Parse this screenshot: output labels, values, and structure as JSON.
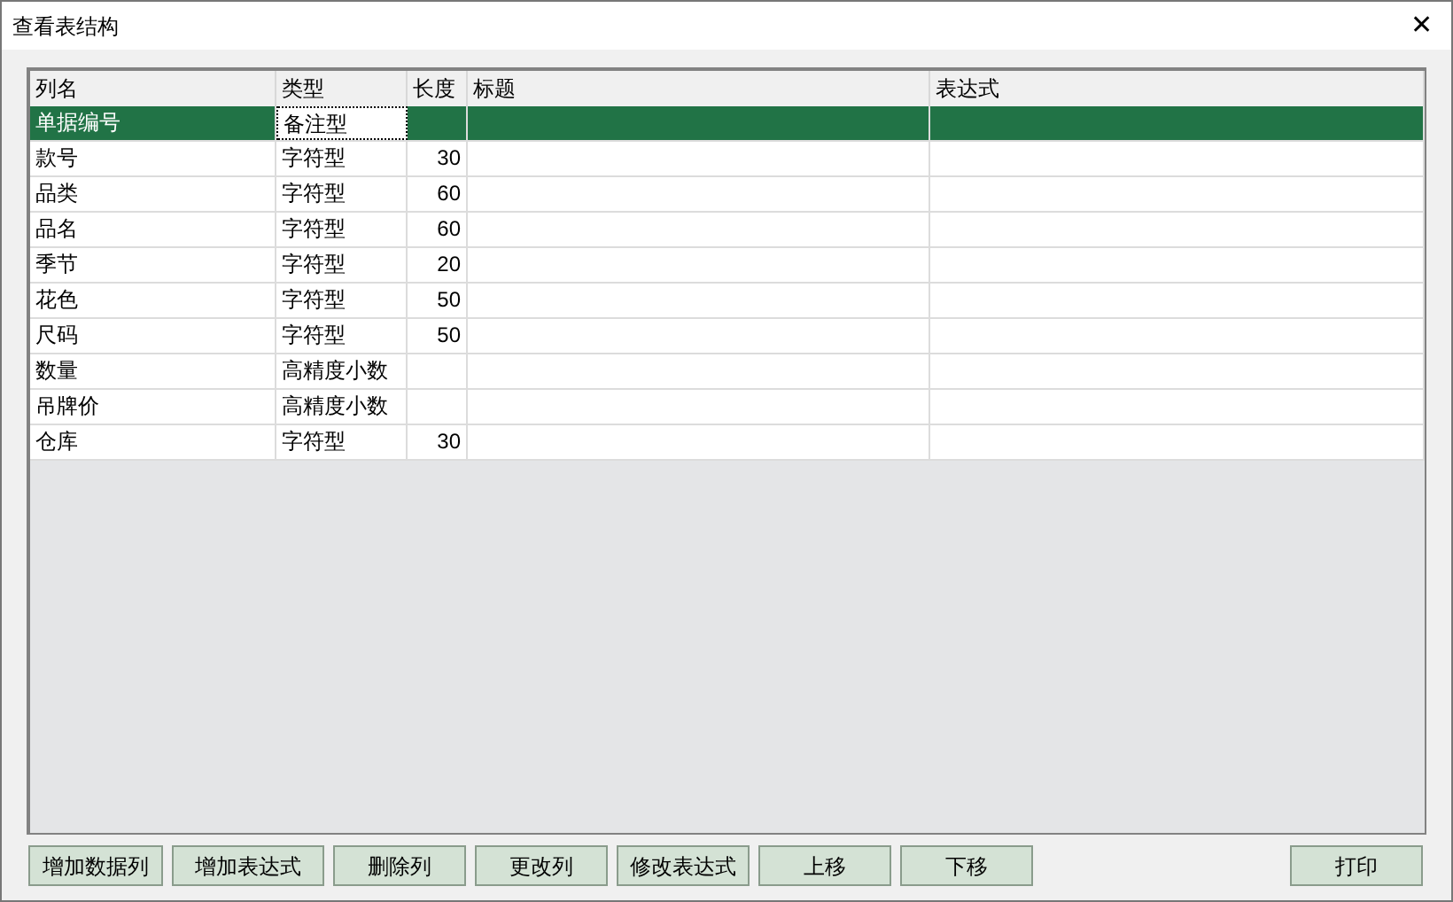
{
  "window": {
    "title": "查看表结构",
    "close": "✕"
  },
  "table": {
    "columns": [
      {
        "label": "列名",
        "kind": "name"
      },
      {
        "label": "类型",
        "kind": "type"
      },
      {
        "label": "长度",
        "kind": "length"
      },
      {
        "label": "标题",
        "kind": "title"
      },
      {
        "label": "表达式",
        "kind": "expr"
      }
    ],
    "rows": [
      {
        "name": "单据编号",
        "type": "备注型",
        "selected": true,
        "focused": true
      },
      {
        "name": "款号",
        "type": "字符型",
        "length": "30",
        "selected": false,
        "focused": false
      },
      {
        "name": "品类",
        "type": "字符型",
        "length": "60",
        "selected": false,
        "focused": false
      },
      {
        "name": "品名",
        "type": "字符型",
        "length": "60",
        "selected": false,
        "focused": false
      },
      {
        "name": "季节",
        "type": "字符型",
        "length": "20",
        "selected": false,
        "focused": false
      },
      {
        "name": "花色",
        "type": "字符型",
        "length": "50",
        "selected": false,
        "focused": false
      },
      {
        "name": "尺码",
        "type": "字符型",
        "length": "50",
        "selected": false,
        "focused": false
      },
      {
        "name": "数量",
        "type": "高精度小数",
        "selected": false,
        "focused": false
      },
      {
        "name": "吊牌价",
        "type": "高精度小数",
        "selected": false,
        "focused": false
      },
      {
        "name": "仓库",
        "type": "字符型",
        "length": "30",
        "selected": false,
        "focused": false
      }
    ]
  },
  "buttons": [
    {
      "label": "增加数据列",
      "kind": "left"
    },
    {
      "label": "增加表达式",
      "kind": "left"
    },
    {
      "label": "删除列",
      "kind": "left"
    },
    {
      "label": "更改列",
      "kind": "left"
    },
    {
      "label": "修改表达式",
      "kind": "left"
    },
    {
      "label": "上移",
      "kind": "left"
    },
    {
      "label": "下移",
      "kind": "left"
    },
    {
      "label": "打印",
      "kind": "right"
    }
  ]
}
